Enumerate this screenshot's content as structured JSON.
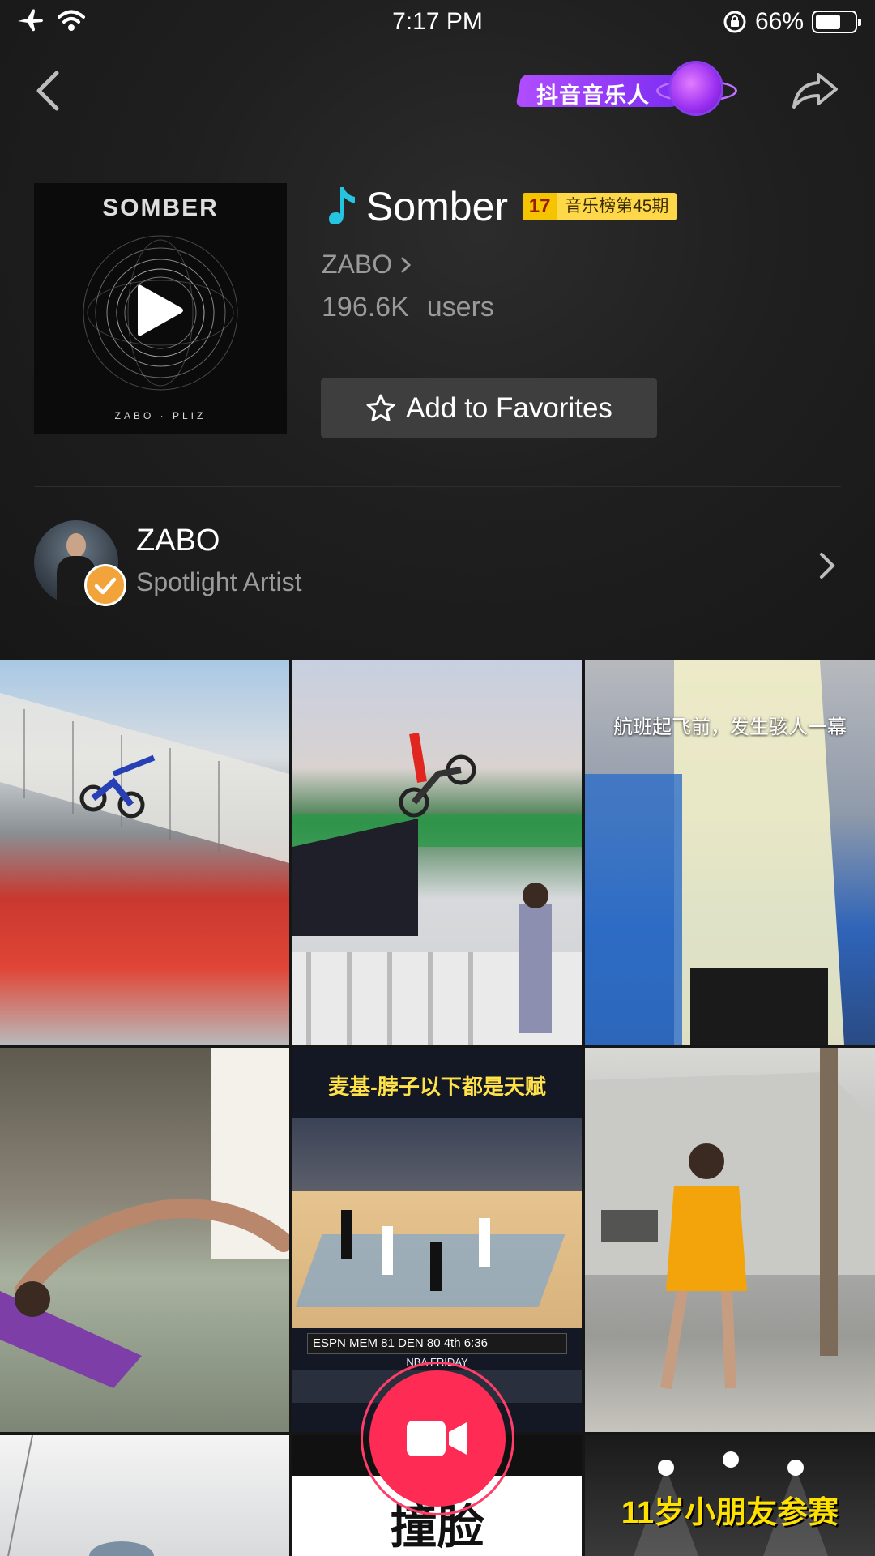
{
  "status_bar": {
    "time": "7:17 PM",
    "battery": "66%",
    "battery_level": 0.66,
    "icons": [
      "airplane-icon",
      "wifi-icon",
      "rotation-lock-icon",
      "battery-icon"
    ]
  },
  "header": {
    "back_icon": "chevron-left-icon",
    "badge_text": "抖音音乐人",
    "share_icon": "share-arrow-icon"
  },
  "song": {
    "title": "Somber",
    "album_title": "SOMBER",
    "album_footer": "ZABO · PLIZ",
    "chart_number": "17",
    "chart_label": "音乐榜第45期",
    "artist": "ZABO",
    "user_count": "196.6K",
    "users_label": "users",
    "favorite_label": "Add to Favorites"
  },
  "artist_row": {
    "name": "ZABO",
    "subtitle": "Spotlight Artist"
  },
  "videos": [
    {
      "caption": ""
    },
    {
      "caption": ""
    },
    {
      "caption": "航班起飞前，发生骇人一幕"
    },
    {
      "caption": ""
    },
    {
      "caption": "麦基-脖子以下都是天赋",
      "scoreboard": "ESPN  MEM 81  DEN 80  4th 6:36",
      "sub": "NBA FRIDAY"
    },
    {
      "caption": ""
    },
    {
      "caption": ""
    },
    {
      "caption": "撞脸"
    },
    {
      "caption": "11岁小朋友参赛"
    }
  ],
  "colors": {
    "accent": "#fe2c55",
    "badge_purple": "#9a2ff0",
    "chart_yellow": "#ffd84a",
    "verified_orange": "#f2a43a"
  }
}
